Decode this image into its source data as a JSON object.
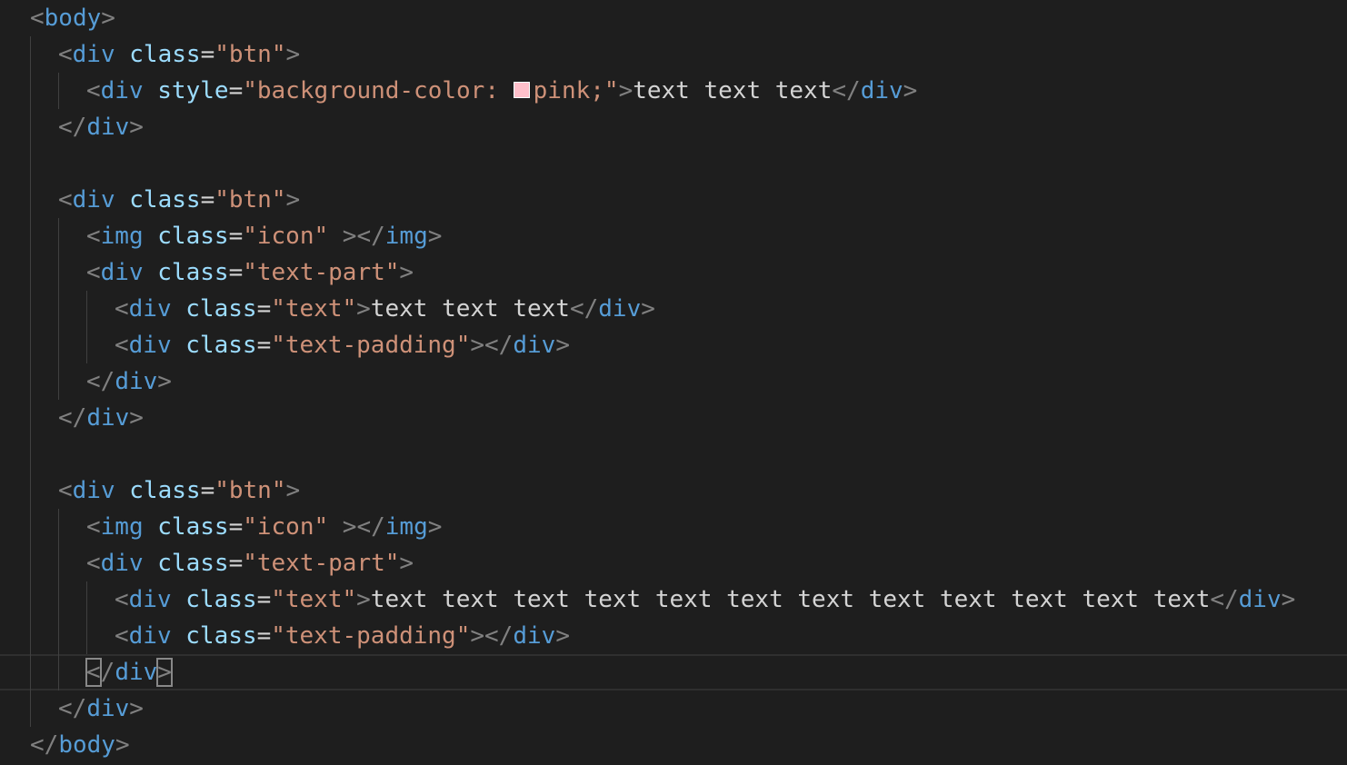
{
  "editor": {
    "theme": "dark",
    "colors": {
      "background": "#1e1e1e",
      "tag": "#569cd6",
      "attribute": "#9cdcfe",
      "string": "#ce9178",
      "punctuation": "#808080",
      "text": "#d4d4d4",
      "swatch": "#ffc0cb"
    },
    "current_line_index": 18,
    "lines": [
      {
        "indent": 0,
        "tokens": [
          {
            "t": "bracket",
            "v": "<"
          },
          {
            "t": "tag",
            "v": "body"
          },
          {
            "t": "bracket",
            "v": ">"
          }
        ]
      },
      {
        "indent": 1,
        "tokens": [
          {
            "t": "bracket",
            "v": "<"
          },
          {
            "t": "tag",
            "v": "div"
          },
          {
            "t": "text",
            "v": " "
          },
          {
            "t": "attr",
            "v": "class"
          },
          {
            "t": "eq",
            "v": "="
          },
          {
            "t": "str",
            "v": "\"btn\""
          },
          {
            "t": "bracket",
            "v": ">"
          }
        ]
      },
      {
        "indent": 2,
        "tokens": [
          {
            "t": "bracket",
            "v": "<"
          },
          {
            "t": "tag",
            "v": "div"
          },
          {
            "t": "text",
            "v": " "
          },
          {
            "t": "attr",
            "v": "style"
          },
          {
            "t": "eq",
            "v": "="
          },
          {
            "t": "str",
            "v": "\"background-color: "
          },
          {
            "t": "swatch",
            "v": "pink"
          },
          {
            "t": "str",
            "v": "pink;\""
          },
          {
            "t": "bracket",
            "v": ">"
          },
          {
            "t": "text",
            "v": "text text text"
          },
          {
            "t": "bracket",
            "v": "</"
          },
          {
            "t": "tag",
            "v": "div"
          },
          {
            "t": "bracket",
            "v": ">"
          }
        ]
      },
      {
        "indent": 1,
        "tokens": [
          {
            "t": "bracket",
            "v": "</"
          },
          {
            "t": "tag",
            "v": "div"
          },
          {
            "t": "bracket",
            "v": ">"
          }
        ]
      },
      {
        "indent": 0,
        "tokens": []
      },
      {
        "indent": 1,
        "tokens": [
          {
            "t": "bracket",
            "v": "<"
          },
          {
            "t": "tag",
            "v": "div"
          },
          {
            "t": "text",
            "v": " "
          },
          {
            "t": "attr",
            "v": "class"
          },
          {
            "t": "eq",
            "v": "="
          },
          {
            "t": "str",
            "v": "\"btn\""
          },
          {
            "t": "bracket",
            "v": ">"
          }
        ]
      },
      {
        "indent": 2,
        "tokens": [
          {
            "t": "bracket",
            "v": "<"
          },
          {
            "t": "tag",
            "v": "img"
          },
          {
            "t": "text",
            "v": " "
          },
          {
            "t": "attr",
            "v": "class"
          },
          {
            "t": "eq",
            "v": "="
          },
          {
            "t": "str",
            "v": "\"icon\""
          },
          {
            "t": "text",
            "v": " "
          },
          {
            "t": "bracket",
            "v": "></"
          },
          {
            "t": "tag",
            "v": "img"
          },
          {
            "t": "bracket",
            "v": ">"
          }
        ]
      },
      {
        "indent": 2,
        "tokens": [
          {
            "t": "bracket",
            "v": "<"
          },
          {
            "t": "tag",
            "v": "div"
          },
          {
            "t": "text",
            "v": " "
          },
          {
            "t": "attr",
            "v": "class"
          },
          {
            "t": "eq",
            "v": "="
          },
          {
            "t": "str",
            "v": "\"text-part\""
          },
          {
            "t": "bracket",
            "v": ">"
          }
        ]
      },
      {
        "indent": 3,
        "tokens": [
          {
            "t": "bracket",
            "v": "<"
          },
          {
            "t": "tag",
            "v": "div"
          },
          {
            "t": "text",
            "v": " "
          },
          {
            "t": "attr",
            "v": "class"
          },
          {
            "t": "eq",
            "v": "="
          },
          {
            "t": "str",
            "v": "\"text\""
          },
          {
            "t": "bracket",
            "v": ">"
          },
          {
            "t": "text",
            "v": "text text text"
          },
          {
            "t": "bracket",
            "v": "</"
          },
          {
            "t": "tag",
            "v": "div"
          },
          {
            "t": "bracket",
            "v": ">"
          }
        ]
      },
      {
        "indent": 3,
        "tokens": [
          {
            "t": "bracket",
            "v": "<"
          },
          {
            "t": "tag",
            "v": "div"
          },
          {
            "t": "text",
            "v": " "
          },
          {
            "t": "attr",
            "v": "class"
          },
          {
            "t": "eq",
            "v": "="
          },
          {
            "t": "str",
            "v": "\"text-padding\""
          },
          {
            "t": "bracket",
            "v": "></"
          },
          {
            "t": "tag",
            "v": "div"
          },
          {
            "t": "bracket",
            "v": ">"
          }
        ]
      },
      {
        "indent": 2,
        "tokens": [
          {
            "t": "bracket",
            "v": "</"
          },
          {
            "t": "tag",
            "v": "div"
          },
          {
            "t": "bracket",
            "v": ">"
          }
        ]
      },
      {
        "indent": 1,
        "tokens": [
          {
            "t": "bracket",
            "v": "</"
          },
          {
            "t": "tag",
            "v": "div"
          },
          {
            "t": "bracket",
            "v": ">"
          }
        ]
      },
      {
        "indent": 0,
        "tokens": []
      },
      {
        "indent": 1,
        "tokens": [
          {
            "t": "bracket",
            "v": "<"
          },
          {
            "t": "tag",
            "v": "div"
          },
          {
            "t": "text",
            "v": " "
          },
          {
            "t": "attr",
            "v": "class"
          },
          {
            "t": "eq",
            "v": "="
          },
          {
            "t": "str",
            "v": "\"btn\""
          },
          {
            "t": "bracket",
            "v": ">"
          }
        ]
      },
      {
        "indent": 2,
        "tokens": [
          {
            "t": "bracket",
            "v": "<"
          },
          {
            "t": "tag",
            "v": "img"
          },
          {
            "t": "text",
            "v": " "
          },
          {
            "t": "attr",
            "v": "class"
          },
          {
            "t": "eq",
            "v": "="
          },
          {
            "t": "str",
            "v": "\"icon\""
          },
          {
            "t": "text",
            "v": " "
          },
          {
            "t": "bracket",
            "v": "></"
          },
          {
            "t": "tag",
            "v": "img"
          },
          {
            "t": "bracket",
            "v": ">"
          }
        ]
      },
      {
        "indent": 2,
        "tokens": [
          {
            "t": "bracket",
            "v": "<"
          },
          {
            "t": "tag",
            "v": "div"
          },
          {
            "t": "text",
            "v": " "
          },
          {
            "t": "attr",
            "v": "class"
          },
          {
            "t": "eq",
            "v": "="
          },
          {
            "t": "str",
            "v": "\"text-part\""
          },
          {
            "t": "bracket",
            "v": ">"
          }
        ]
      },
      {
        "indent": 3,
        "tokens": [
          {
            "t": "bracket",
            "v": "<"
          },
          {
            "t": "tag",
            "v": "div"
          },
          {
            "t": "text",
            "v": " "
          },
          {
            "t": "attr",
            "v": "class"
          },
          {
            "t": "eq",
            "v": "="
          },
          {
            "t": "str",
            "v": "\"text\""
          },
          {
            "t": "bracket",
            "v": ">"
          },
          {
            "t": "text",
            "v": "text text text text text text text text text text text text"
          },
          {
            "t": "bracket",
            "v": "</"
          },
          {
            "t": "tag",
            "v": "div"
          },
          {
            "t": "bracket",
            "v": ">"
          }
        ]
      },
      {
        "indent": 3,
        "tokens": [
          {
            "t": "bracket",
            "v": "<"
          },
          {
            "t": "tag",
            "v": "div"
          },
          {
            "t": "text",
            "v": " "
          },
          {
            "t": "attr",
            "v": "class"
          },
          {
            "t": "eq",
            "v": "="
          },
          {
            "t": "str",
            "v": "\"text-padding\""
          },
          {
            "t": "bracket",
            "v": "></"
          },
          {
            "t": "tag",
            "v": "div"
          },
          {
            "t": "bracket",
            "v": ">"
          }
        ]
      },
      {
        "indent": 2,
        "tokens": [
          {
            "t": "bracket-match",
            "v": "<"
          },
          {
            "t": "bracket",
            "v": "/"
          },
          {
            "t": "tag",
            "v": "div"
          },
          {
            "t": "bracket-match",
            "v": ">"
          }
        ]
      },
      {
        "indent": 1,
        "tokens": [
          {
            "t": "bracket",
            "v": "</"
          },
          {
            "t": "tag",
            "v": "div"
          },
          {
            "t": "bracket",
            "v": ">"
          }
        ]
      },
      {
        "indent": 0,
        "tokens": [
          {
            "t": "bracket",
            "v": "</"
          },
          {
            "t": "tag",
            "v": "body"
          },
          {
            "t": "bracket",
            "v": ">"
          }
        ]
      }
    ]
  }
}
